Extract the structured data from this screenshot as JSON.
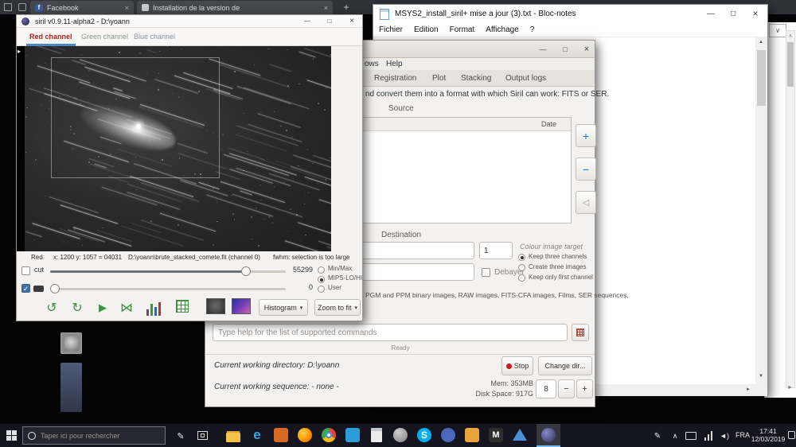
{
  "icons": {
    "minimize": "—",
    "maximize": "□",
    "close": "×",
    "close_small": "×",
    "new_tab": "+",
    "add": "+",
    "remove": "−",
    "clear": "◁",
    "caret": "▾",
    "undo": "↺",
    "redo": "↻",
    "play": "▶",
    "flip": "⋈",
    "check": "✓",
    "up": "▲",
    "down": "▼",
    "left": "◄",
    "right": "►",
    "chev_up": "∧",
    "chev_down": "∨",
    "pen": "✎",
    "pane_arrow": "▸",
    "facebook_f": "f",
    "edge_e": "e",
    "skype_s": "S",
    "m_letter": "M",
    "speaker": "◄)"
  },
  "browser": {
    "tab_facebook": "Facebook",
    "tab_install": "Installation de la version de"
  },
  "notepad": {
    "title": "MSYS2_install_siril+ mise a jour (3).txt - Bloc-notes",
    "menus": [
      "Fichier",
      "Edition",
      "Format",
      "Affichage",
      "?"
    ]
  },
  "siril_image": {
    "title": "siril v0.9.11-alpha2 - D:\\yoann",
    "tab_red": "Red channel",
    "tab_green": "Green channel",
    "tab_blue": "Blue channel",
    "status_channel": "Red",
    "status_coords": "x: 1200 y: 1057 = 04031",
    "status_file": "D:\\yoann\\brute_stacked_comete.fit (channel 0)",
    "status_fwhm": "fwhm: selection is too large",
    "cut_label": "cut",
    "hi_value": "55299",
    "lo_value": "0",
    "radio_minmax": "Min/Max",
    "radio_mips": "MIPS-LO/HI",
    "radio_user": "User",
    "btn_histogram": "Histogram",
    "btn_zoom": "Zoom to fit"
  },
  "siril_main": {
    "menu_fragment": "ows",
    "menu_help": "Help",
    "tab_registration": "Registration",
    "tab_plot": "Plot",
    "tab_stacking": "Stacking",
    "tab_output": "Output logs",
    "convert_text": "nd convert them into a format with which Siril can work: FITS or SER.",
    "source_label": "Source",
    "date_header": "Date",
    "destination_label": "Destination",
    "start_index": "1",
    "debayer_label": "Debayer",
    "colour_target_label": "Colour image target",
    "opt_keep_three": "Keep three channels",
    "opt_create_three": "Create three images",
    "opt_keep_first": "Keep only first channel",
    "formats_text": "PGM and PPM binary images, RAW images, FITS-CFA images, Films, SER sequences,",
    "command_placeholder": "Type help for the list of supported commands",
    "ready_label": "Ready",
    "cwd_text": "Current working directory: D:\\yoann",
    "cws_text": "Current working sequence: - none -",
    "stop_label": "Stop",
    "change_dir_label": "Change dir...",
    "mem_text": "Mem: 353MB",
    "disk_text": "Disk Space: 917G",
    "threads_value": "8"
  },
  "taskbar": {
    "search_placeholder": "Taper ici pour rechercher",
    "language": "FRA",
    "time": "17:41",
    "date": "12/03/2019",
    "app_icons": [
      "pen",
      "task-view",
      "file-explorer",
      "edge",
      "orange-app",
      "firefox",
      "chrome",
      "teal-app",
      "calculator",
      "gimp",
      "skype",
      "round-blue-app",
      "yellow-app",
      "m-app",
      "triangle-app",
      "siril-active"
    ]
  }
}
